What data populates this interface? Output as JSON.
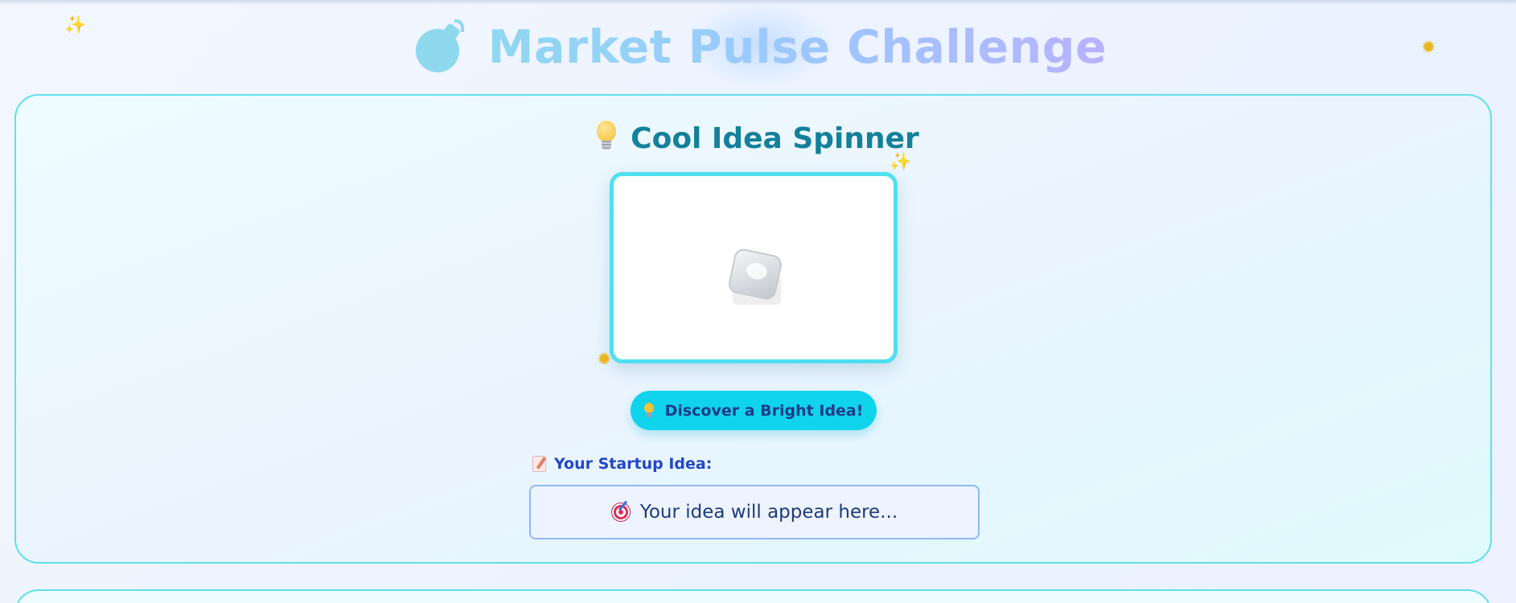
{
  "header": {
    "title": "Market Pulse Challenge",
    "icon": "bomb-icon"
  },
  "spinner_section": {
    "title": "Cool Idea Spinner",
    "title_icon": "light-bulb-icon",
    "display_icon": "ice-cube-icon",
    "button_label": "Discover a Bright Idea!",
    "button_icon": "light-bulb-icon"
  },
  "idea": {
    "label": "Your Startup Idea:",
    "label_icon": "memo-icon",
    "value": "Your idea will appear here...",
    "value_icon": "direct-hit-icon"
  },
  "colors": {
    "accent": "#10d3ec",
    "card_border": "#5fe0ea",
    "title_text": "#14809a",
    "label_text": "#2346c8"
  }
}
